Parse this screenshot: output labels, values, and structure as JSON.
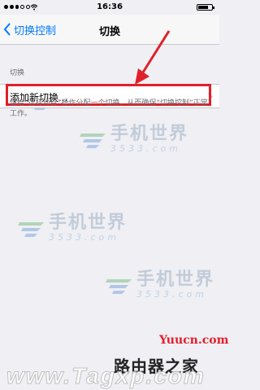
{
  "status_bar": {
    "time": "16:36"
  },
  "nav": {
    "back_label": "切换控制",
    "title": "切换"
  },
  "section": {
    "header": "切换",
    "add_switch_label": "添加新切换...",
    "footer": "请给“选择项目”操作分配一个切换，从而确保“切换控制”正常工作。"
  },
  "watermarks": {
    "main": "手机世界",
    "sub": "3533.com",
    "site": "Yuucn.com",
    "bottom_cn": "路由器之家",
    "bottom_url": "www.Tagxp.com"
  },
  "colors": {
    "accent": "#007aff",
    "highlight": "#e0202a",
    "background": "#efeff4"
  }
}
